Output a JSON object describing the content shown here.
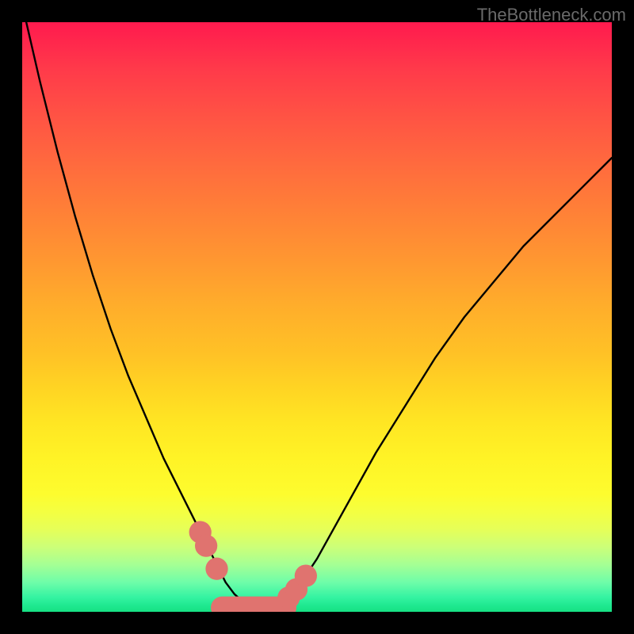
{
  "watermark": "TheBottleneck.com",
  "chart_data": {
    "type": "line",
    "title": "",
    "xlabel": "",
    "ylabel": "",
    "xlim": [
      0,
      100
    ],
    "ylim": [
      0,
      100
    ],
    "grid": false,
    "series": [
      {
        "name": "bottleneck-curve",
        "x": [
          0,
          3,
          6,
          9,
          12,
          15,
          18,
          21,
          24,
          27,
          30,
          33,
          34.5,
          36,
          38,
          40,
          42,
          44,
          46,
          50,
          55,
          60,
          65,
          70,
          75,
          80,
          85,
          90,
          95,
          100
        ],
        "y": [
          103,
          90,
          78,
          67,
          57,
          48,
          40,
          33,
          26,
          20,
          14,
          8,
          5,
          3,
          1.2,
          0.7,
          0.7,
          1.2,
          3,
          9,
          18,
          27,
          35,
          43,
          50,
          56,
          62,
          67,
          72,
          77
        ]
      }
    ],
    "markers": [
      {
        "name": "dot-left-upper",
        "x": 30.2,
        "y": 13.5,
        "r": 1.9,
        "fill": "#e0736f"
      },
      {
        "name": "dot-left-mid",
        "x": 31.2,
        "y": 11.2,
        "r": 1.9,
        "fill": "#e0736f"
      },
      {
        "name": "dot-left-low",
        "x": 33.0,
        "y": 7.3,
        "r": 1.9,
        "fill": "#e0736f"
      },
      {
        "name": "dot-right-low",
        "x": 45.2,
        "y": 2.4,
        "r": 1.9,
        "fill": "#e0736f"
      },
      {
        "name": "dot-right-mid",
        "x": 46.5,
        "y": 3.8,
        "r": 1.9,
        "fill": "#e0736f"
      },
      {
        "name": "dot-right-up",
        "x": 48.1,
        "y": 6.1,
        "r": 1.9,
        "fill": "#e0736f"
      }
    ],
    "valley_bar": {
      "x0": 33.9,
      "x1": 44.6,
      "y": 0.7,
      "stroke": "#e0736f",
      "width": 3.8
    },
    "colors": {
      "curve_stroke": "#000000",
      "marker_fill": "#e0736f",
      "frame_bg": "#000000"
    }
  }
}
